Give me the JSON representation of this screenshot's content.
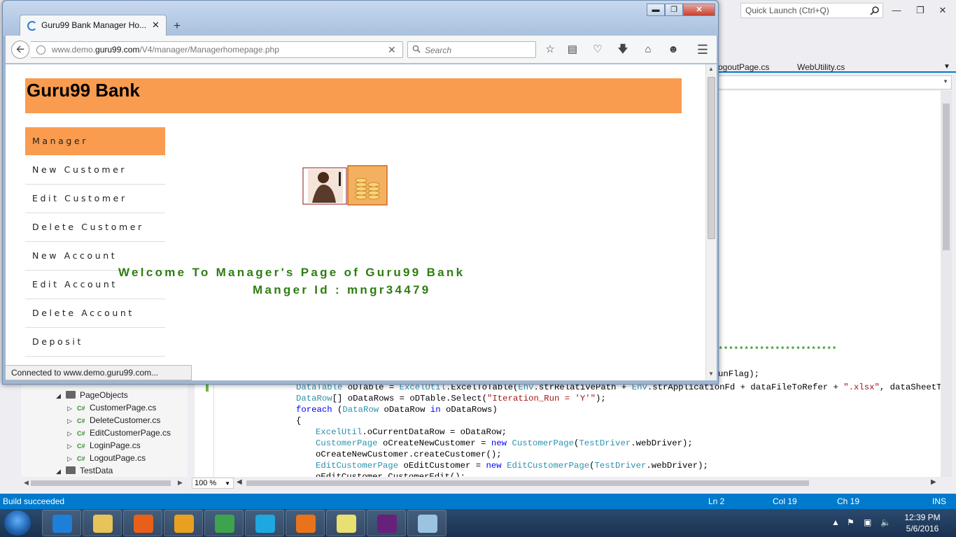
{
  "vs": {
    "quick_launch": "Quick Launch (Ctrl+Q)",
    "doc_tabs": [
      "ogoutPage.cs",
      "WebUtility.cs"
    ],
    "code_fragments": {
      "stars": "***********************",
      "runflag": "unFlag);"
    },
    "code": [
      {
        "parts": [
          {
            "c": "ty",
            "t": "DataTable"
          },
          {
            "c": "",
            "t": " oDTable = "
          },
          {
            "c": "ty",
            "t": "ExcelUtil"
          },
          {
            "c": "",
            "t": ".ExcelToTable("
          },
          {
            "c": "ty",
            "t": "Env"
          },
          {
            "c": "",
            "t": ".strRelativePath + "
          },
          {
            "c": "ty",
            "t": "Env"
          },
          {
            "c": "",
            "t": ".strApplicationFd + dataFileToRefer + "
          },
          {
            "c": "st",
            "t": "\".xlsx\""
          },
          {
            "c": "",
            "t": ", dataSheetToRefer"
          }
        ],
        "indent": 117
      },
      {
        "parts": [
          {
            "c": "ty",
            "t": "DataRow"
          },
          {
            "c": "",
            "t": "[] oDataRows = oDTable.Select("
          },
          {
            "c": "st",
            "t": "\"Iteration_Run = 'Y'\""
          },
          {
            "c": "",
            "t": ");"
          }
        ],
        "indent": 117
      },
      {
        "parts": [
          {
            "c": "kw",
            "t": "foreach"
          },
          {
            "c": "",
            "t": " ("
          },
          {
            "c": "ty",
            "t": "DataRow"
          },
          {
            "c": "",
            "t": " oDataRow "
          },
          {
            "c": "kw",
            "t": "in"
          },
          {
            "c": "",
            "t": " oDataRows)"
          }
        ],
        "indent": 117
      },
      {
        "parts": [
          {
            "c": "",
            "t": "{"
          }
        ],
        "indent": 117
      },
      {
        "parts": [
          {
            "c": "ty",
            "t": "ExcelUtil"
          },
          {
            "c": "",
            "t": ".oCurrentDataRow = oDataRow;"
          }
        ],
        "indent": 145
      },
      {
        "parts": [
          {
            "c": "ty",
            "t": "CustomerPage"
          },
          {
            "c": "",
            "t": " oCreateNewCustomer = "
          },
          {
            "c": "kw",
            "t": "new"
          },
          {
            "c": "",
            "t": " "
          },
          {
            "c": "ty",
            "t": "CustomerPage"
          },
          {
            "c": "",
            "t": "("
          },
          {
            "c": "ty",
            "t": "TestDriver"
          },
          {
            "c": "",
            "t": ".webDriver);"
          }
        ],
        "indent": 145
      },
      {
        "parts": [
          {
            "c": "",
            "t": "oCreateNewCustomer.createCustomer();"
          }
        ],
        "indent": 145
      },
      {
        "parts": [
          {
            "c": "ty",
            "t": "EditCustomerPage"
          },
          {
            "c": "",
            "t": " oEditCustomer = "
          },
          {
            "c": "kw",
            "t": "new"
          },
          {
            "c": "",
            "t": " "
          },
          {
            "c": "ty",
            "t": "EditCustomerPage"
          },
          {
            "c": "",
            "t": "("
          },
          {
            "c": "ty",
            "t": "TestDriver"
          },
          {
            "c": "",
            "t": ".webDriver);"
          }
        ],
        "indent": 145
      },
      {
        "parts": [
          {
            "c": "",
            "t": "oEditCustomer.CustomerEdit();"
          }
        ],
        "indent": 145
      }
    ],
    "zoom": "100 %",
    "solution_tree": [
      {
        "label": "PageObjects",
        "arrow": "◢",
        "type": "folder",
        "indent": 50
      },
      {
        "label": "CustomerPage.cs",
        "arrow": "▷",
        "type": "cs",
        "indent": 66
      },
      {
        "label": "DeleteCustomer.cs",
        "arrow": "▷",
        "type": "cs",
        "indent": 66
      },
      {
        "label": "EditCustomerPage.cs",
        "arrow": "▷",
        "type": "cs",
        "indent": 66
      },
      {
        "label": "LoginPage.cs",
        "arrow": "▷",
        "type": "cs",
        "indent": 66
      },
      {
        "label": "LogoutPage.cs",
        "arrow": "▷",
        "type": "cs",
        "indent": 66
      },
      {
        "label": "TestData",
        "arrow": "◢",
        "type": "folder",
        "indent": 50
      }
    ],
    "status": {
      "message": "Build succeeded",
      "ln": "Ln 2",
      "col": "Col 19",
      "ch": "Ch 19",
      "ins": "INS"
    }
  },
  "taskbar": {
    "time": "12:39 PM",
    "date": "5/6/2016",
    "apps": [
      {
        "name": "ie",
        "color": "#1e7fd8"
      },
      {
        "name": "explorer",
        "color": "#e8c35a"
      },
      {
        "name": "media-player",
        "color": "#e85f1a"
      },
      {
        "name": "outlook",
        "color": "#e8a020"
      },
      {
        "name": "chrome",
        "color": "#3da44d"
      },
      {
        "name": "skype",
        "color": "#1ea7e1"
      },
      {
        "name": "firefox",
        "color": "#e8731a"
      },
      {
        "name": "sticky-notes",
        "color": "#e8e070"
      },
      {
        "name": "visual-studio",
        "color": "#68217a"
      },
      {
        "name": "notepad",
        "color": "#9bc4e2"
      }
    ]
  },
  "firefox": {
    "tab_title": "Guru99 Bank Manager Ho...",
    "url_prefix": "www.demo.",
    "url_domain": "guru99.com",
    "url_path": "/V4/manager/Managerhomepage.php",
    "search_placeholder": "Search",
    "status_text": "Connected to www.demo.guru99.com..."
  },
  "page": {
    "bank_title": "Guru99 Bank",
    "menu": [
      "Manager",
      "New Customer",
      "Edit Customer",
      "Delete Customer",
      "New Account",
      "Edit Account",
      "Delete Account",
      "Deposit"
    ],
    "welcome": "Welcome To Manager's Page of Guru99 Bank",
    "manager_id": "Manger Id : mngr34479"
  },
  "colors": {
    "accent_orange": "#f99c4f",
    "welcome_green": "#2e7d12",
    "vs_blue": "#007acc"
  }
}
